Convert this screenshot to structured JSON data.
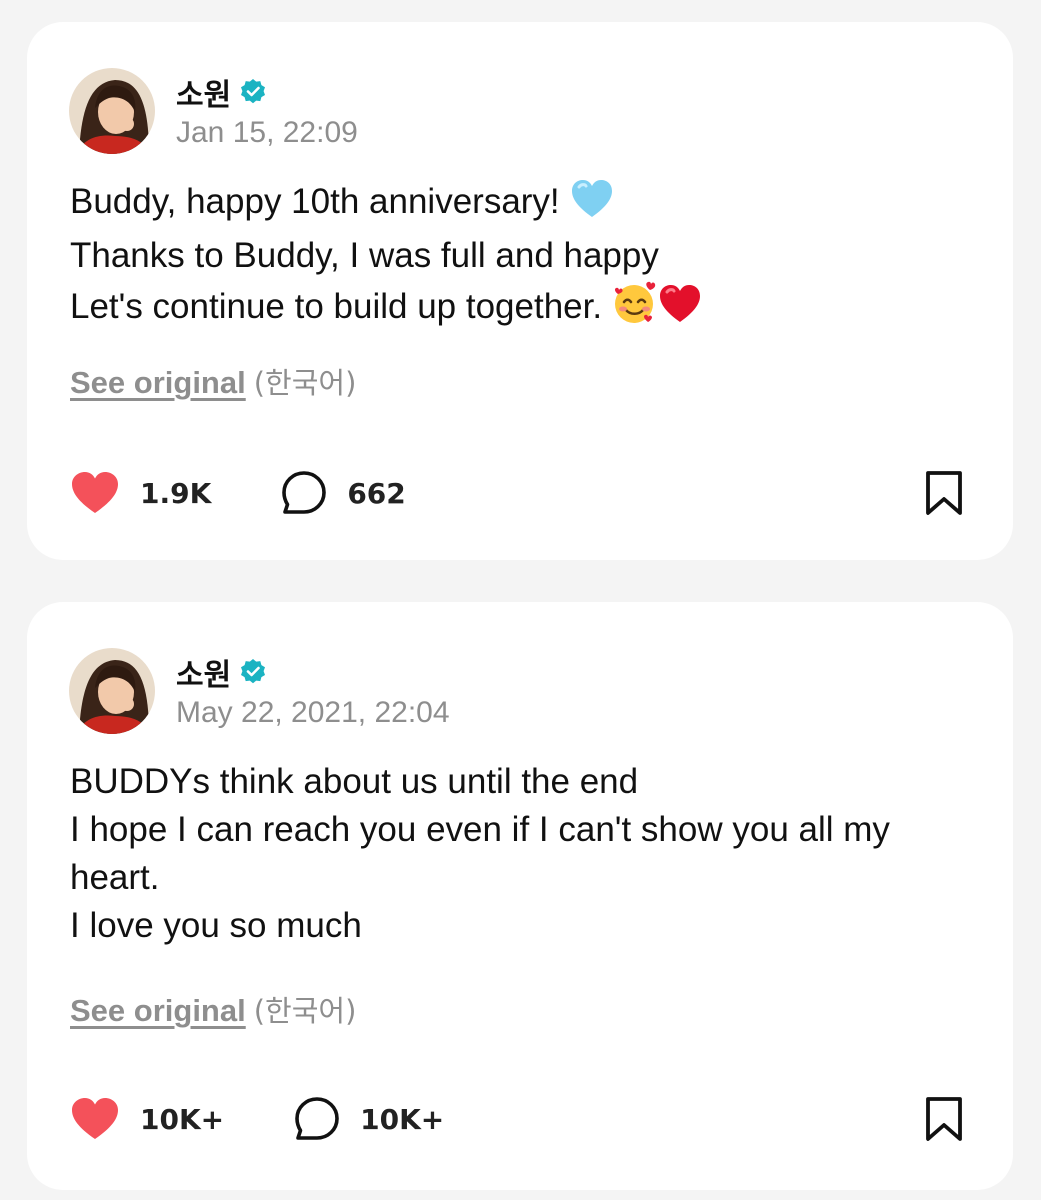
{
  "colors": {
    "background": "#f4f4f4",
    "card": "#ffffff",
    "verified_badge": "#1bb3c2",
    "like_heart": "#f4515a",
    "muted_text": "#8e8e8e"
  },
  "posts": [
    {
      "author": "소원",
      "verified": true,
      "avatar_icon": "profile-photo",
      "date": "Jan 15, 22:09",
      "lines": [
        "Buddy, happy 10th anniversary!",
        "Thanks to Buddy, I was full and happy",
        "Let's continue to build up together."
      ],
      "emoji_names": [
        "light-blue-heart",
        "smiling-face-with-hearts",
        "red-heart"
      ],
      "see_original_label": "See original",
      "original_language": "(한국어)",
      "likes": "1.9K",
      "comments": "662"
    },
    {
      "author": "소원",
      "verified": true,
      "avatar_icon": "profile-photo",
      "date": "May 22, 2021, 22:04",
      "lines": [
        "BUDDYs think about us until the end",
        "I hope I can reach you even if I can't show you all my",
        "heart.",
        "I love you so much"
      ],
      "see_original_label": "See original",
      "original_language": "(한국어)",
      "likes": "10K+",
      "comments": "10K+"
    }
  ]
}
